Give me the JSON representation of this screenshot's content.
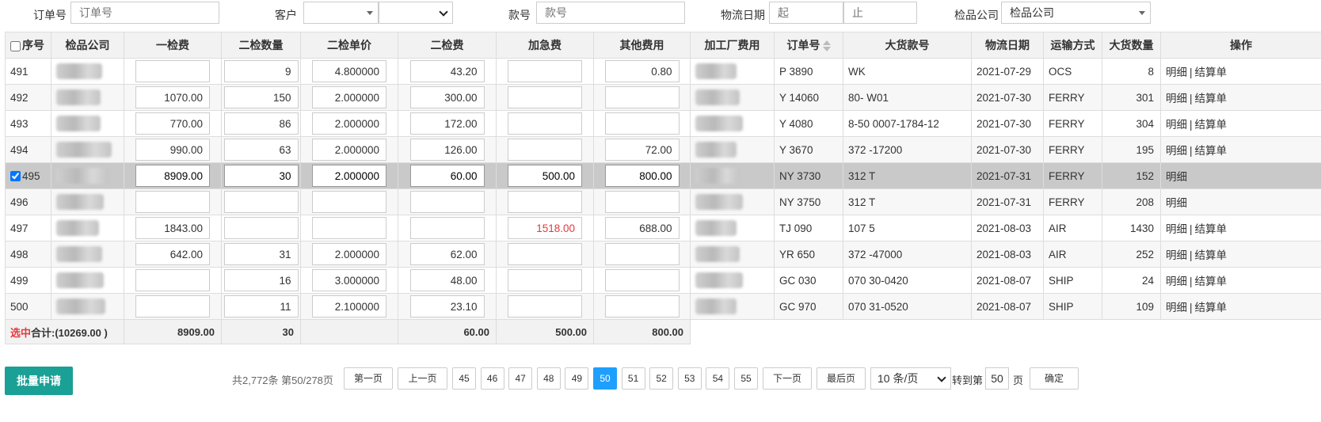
{
  "filters": {
    "order_no_label": "订单号",
    "order_no_placeholder": "订单号",
    "customer_label": "客户",
    "style_label": "款号",
    "style_placeholder": "款号",
    "date_label": "物流日期",
    "date_start_placeholder": "起",
    "date_end_placeholder": "止",
    "inspection_label": "检品公司",
    "inspection_value": "检品公司"
  },
  "table": {
    "headers": {
      "seq": "序号",
      "inspection_company": "检品公司",
      "first_fee": "一检费",
      "second_qty": "二检数量",
      "second_price": "二检单价",
      "second_fee": "二检费",
      "rush_fee": "加急费",
      "other_fee": "其他费用",
      "factory_fee": "加工厂费用",
      "order_no": "订单号",
      "bulk_style": "大货款号",
      "ship_date": "物流日期",
      "transport": "运输方式",
      "bulk_qty": "大货数量",
      "actions": "操作"
    },
    "rows": [
      {
        "seq": "491",
        "checked": false,
        "first_fee": "",
        "second_qty": "9",
        "second_price": "4.800000",
        "second_fee": "43.20",
        "rush_fee": "",
        "other_fee": "0.80",
        "order_no": "P    3890",
        "bulk_style": "WK",
        "ship_date": "2021-07-29",
        "transport": "OCS",
        "bulk_qty": "8",
        "detail": "明细",
        "settle": "结算单"
      },
      {
        "seq": "492",
        "checked": false,
        "first_fee": "1070.00",
        "second_qty": "150",
        "second_price": "2.000000",
        "second_fee": "300.00",
        "rush_fee": "",
        "other_fee": "",
        "order_no": "Y    14060",
        "bulk_style": "80-    W01",
        "ship_date": "2021-07-30",
        "transport": "FERRY",
        "bulk_qty": "301",
        "detail": "明细",
        "settle": "结算单"
      },
      {
        "seq": "493",
        "checked": false,
        "first_fee": "770.00",
        "second_qty": "86",
        "second_price": "2.000000",
        "second_fee": "172.00",
        "rush_fee": "",
        "other_fee": "",
        "order_no": "Y    4080",
        "bulk_style": "8-50      0007-1784-12",
        "ship_date": "2021-07-30",
        "transport": "FERRY",
        "bulk_qty": "304",
        "detail": "明细",
        "settle": "结算单"
      },
      {
        "seq": "494",
        "checked": false,
        "first_fee": "990.00",
        "second_qty": "63",
        "second_price": "2.000000",
        "second_fee": "126.00",
        "rush_fee": "",
        "other_fee": "72.00",
        "order_no": "Y    3670",
        "bulk_style": "372      -17200",
        "ship_date": "2021-07-30",
        "transport": "FERRY",
        "bulk_qty": "195",
        "detail": "明细",
        "settle": "结算单"
      },
      {
        "seq": "495",
        "checked": true,
        "first_fee": "8909.00",
        "second_qty": "30",
        "second_price": "2.000000",
        "second_fee": "60.00",
        "rush_fee": "500.00",
        "other_fee": "800.00",
        "order_no": "NY    3730",
        "bulk_style": "312      T",
        "ship_date": "2021-07-31",
        "transport": "FERRY",
        "bulk_qty": "152",
        "detail": "明细",
        "settle": ""
      },
      {
        "seq": "496",
        "checked": false,
        "first_fee": "",
        "second_qty": "",
        "second_price": "",
        "second_fee": "",
        "rush_fee": "",
        "other_fee": "",
        "order_no": "NY    3750",
        "bulk_style": "312      T",
        "ship_date": "2021-07-31",
        "transport": "FERRY",
        "bulk_qty": "208",
        "detail": "明细",
        "settle": ""
      },
      {
        "seq": "497",
        "checked": false,
        "first_fee": "1843.00",
        "second_qty": "",
        "second_price": "",
        "second_fee": "",
        "rush_fee": "1518.00",
        "other_fee": "688.00",
        "order_no": "TJ    090",
        "bulk_style": "107    5",
        "ship_date": "2021-08-03",
        "transport": "AIR",
        "bulk_qty": "1430",
        "detail": "明细",
        "settle": "结算单"
      },
      {
        "seq": "498",
        "checked": false,
        "first_fee": "642.00",
        "second_qty": "31",
        "second_price": "2.000000",
        "second_fee": "62.00",
        "rush_fee": "",
        "other_fee": "",
        "order_no": "YR    650",
        "bulk_style": "372      -47000",
        "ship_date": "2021-08-03",
        "transport": "AIR",
        "bulk_qty": "252",
        "detail": "明细",
        "settle": "结算单"
      },
      {
        "seq": "499",
        "checked": false,
        "first_fee": "",
        "second_qty": "16",
        "second_price": "3.000000",
        "second_fee": "48.00",
        "rush_fee": "",
        "other_fee": "",
        "order_no": "GC    030",
        "bulk_style": "070    30-0420",
        "ship_date": "2021-08-07",
        "transport": "SHIP",
        "bulk_qty": "24",
        "detail": "明细",
        "settle": "结算单"
      },
      {
        "seq": "500",
        "checked": false,
        "first_fee": "",
        "second_qty": "11",
        "second_price": "2.100000",
        "second_fee": "23.10",
        "rush_fee": "",
        "other_fee": "",
        "order_no": "GC    970",
        "bulk_style": "070    31-0520",
        "ship_date": "2021-08-07",
        "transport": "SHIP",
        "bulk_qty": "109",
        "detail": "明细",
        "settle": "结算单"
      }
    ],
    "total": {
      "selected_label": "选中",
      "sum_label": "合计:(10269.00 )",
      "first_fee": "8909.00",
      "second_qty": "30",
      "second_fee": "60.00",
      "rush_fee": "500.00",
      "other_fee": "800.00"
    }
  },
  "footer": {
    "batch_button": "批量申请",
    "page_info": "共2,772条 第50/278页",
    "first_page": "第一页",
    "prev_page": "上一页",
    "pages": [
      "45",
      "46",
      "47",
      "48",
      "49",
      "50",
      "51",
      "52",
      "53",
      "54",
      "55"
    ],
    "current_page": "50",
    "next_page": "下一页",
    "last_page": "最后页",
    "page_size": "10 条/页",
    "goto_label": "转到第",
    "goto_value": "50",
    "page_unit": "页",
    "confirm": "确定"
  },
  "colors": {
    "selected_row": "#c9c9c9",
    "current_page": "#1e9fff",
    "batch_button": "#1aa094",
    "highlight_text": "#e4393c"
  }
}
